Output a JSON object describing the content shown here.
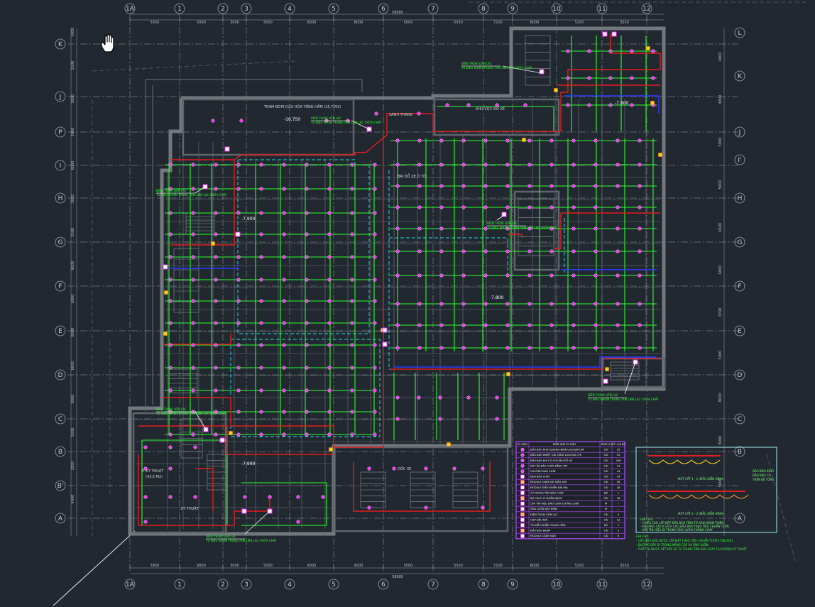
{
  "grid_cols_top": [
    "1A",
    "1",
    "2",
    "3",
    "4",
    "5",
    "6",
    "7",
    "8",
    "9",
    "10",
    "11",
    "12"
  ],
  "grid_cols_bottom": [
    "1A",
    "1",
    "2",
    "3",
    "4",
    "5",
    "6",
    "7",
    "8",
    "9",
    "10",
    "11",
    "12"
  ],
  "grid_rows_left": [
    "K",
    "J",
    "P",
    "I",
    "H",
    "G",
    "F",
    "E",
    "D",
    "C",
    "B",
    "B'",
    "A"
  ],
  "grid_rows_right": [
    "L",
    "K",
    "J",
    "I'",
    "H",
    "G",
    "F",
    "E",
    "D",
    "C",
    "B",
    "A"
  ],
  "dims_top": [
    "5950",
    "5000",
    "3000",
    "5000",
    "8000",
    "8000",
    "5000",
    "5550",
    "7100",
    "8000",
    "5200",
    "3550"
  ],
  "dims_top_total": "58880",
  "dims_bottom": [
    "5950",
    "9000",
    "3000",
    "5000",
    "8000",
    "9000",
    "5000",
    "5550",
    "7100",
    "8000",
    "5200",
    "3550"
  ],
  "dims_bottom_total": "58880",
  "dims_left": [
    "4650",
    "5500",
    "5000",
    "5000",
    "6000",
    "5000",
    "5500",
    "6000",
    "6000",
    "8000",
    "6000",
    "8000",
    "5000",
    "2950",
    "4000"
  ],
  "dims_right": [
    "4000",
    "4800",
    "5000",
    "5000",
    "6500",
    "6000",
    "3700",
    "5000",
    "8000",
    "8000",
    "5000"
  ],
  "rooms": {
    "tank": "TRẠM BƠM CỨU HỎA TẦNG HẦM (25.7 M2)",
    "elev_tank": "-10.750",
    "lobby": "SẢNH THANG",
    "parking_left": "BÃI ĐỖ XE",
    "parking_mid": "KHU VỰC ĐỖ XE",
    "parking_center": "BÃI ĐỖ XE Ô TÔ",
    "ramp": "DỐC XE",
    "tech": "P. KỸ THUẬT",
    "tech_area": "(43.5 M2)",
    "kt_room": "KỸ THUẬT",
    "elev_main": "-7.800",
    "elev_left": "-7.900",
    "elev_right": "-7.800",
    "elev_bottom": "-7.900"
  },
  "callouts": [
    "ĐIỆN THOẠI LIÊN LẠC",
    "TỦ ĐIỀU KHIỂN TRUNG TÂM LIÊN LẠC CHỮA CHÁY"
  ],
  "legend": {
    "headers": [
      "KÝ HIỆU",
      "DIỄN GIẢI KÝ HIỆU",
      "ĐƠN VỊ",
      "SỐ LƯỢNG"
    ],
    "rows": [
      [
        "ĐẦU BÁO KHÓI QUANG ĐIỆN LOẠI ĐỊA CHỈ",
        "CÁI",
        "35"
      ],
      [
        "ĐẦU BÁO NHIỆT GIA TĂNG LOẠI ĐỊA CHỈ",
        "CÁI",
        "12"
      ],
      [
        "ĐẦU BÁO KHÍ CO CHO BÃI ĐỖ XE",
        "CÁI",
        "248"
      ],
      [
        "NÚT ẤN BÁO CHÁY BẰNG TAY",
        "CÁI",
        "14"
      ],
      [
        "CHUÔNG BÁO CHÁY",
        "CÁI",
        "14"
      ],
      [
        "ĐÈN BÁO CHÁY",
        "CÁI",
        "14"
      ],
      [
        "MODULE GIÁM SÁT ĐẦU VÀO",
        "CÁI",
        "26"
      ],
      [
        "MODULE ĐIỀU KHIỂN ĐẦU RA",
        "CÁI",
        "18"
      ],
      [
        "TỦ TRUNG TÂM BÁO CHÁY",
        "BỘ",
        "1"
      ],
      [
        "BỘ CÁCH LY NGẮN MẠCH",
        "CÁI",
        "16"
      ],
      [
        "CÁP TÍN HIỆU BÁO CHÁY CHỐNG CHÁY",
        "M",
        "--"
      ],
      [
        "ỐNG LUỒN DÂY ĐIỆN",
        "M",
        "--"
      ],
      [
        "ĐIỆN THOẠI LIÊN LẠC",
        "CÁI",
        "4"
      ],
      [
        "HỘP ĐẤU NỐI",
        "CÁI",
        "12"
      ],
      [
        "TỦ ĐIỀU KHIỂN TRUNG TÂM",
        "BỘ",
        "1"
      ],
      [
        "ĐẦU BÁO BEAM",
        "CÁI",
        "2"
      ],
      [
        "MODULE CẢNH BÁO",
        "CÁI",
        "6"
      ]
    ]
  },
  "detail": {
    "title_a": "MẶT CẮT 1 - 1 (MẪU ĐIỂN HÌNH)",
    "title_b": "MẶT CẮT 2 - 2 (MẪU ĐIỂN HÌNH)",
    "legend_items": [
      "ĐẦU BÁO KHÓI",
      "ĐẦU BÁO CO",
      "TRẦN BÊ TÔNG"
    ],
    "note_title": "GHI CHÚ:",
    "notes": [
      "- CHIỀU CAO LẮP ĐẶT ĐẦU BÁO TÍNH TỪ SÀN HOÀN THIỆN",
      "- KHOẢNG CÁCH GIỮA CÁC ĐẦU BÁO THEO TIÊU CHUẨN TCVN",
      "- DÂY TÍN HIỆU ĐI TRONG ỐNG LUỒN CHỐNG CHÁY"
    ],
    "footer_notes": [
      "GHI CHÚ:",
      "- CÁC ĐẦU BÁO ĐƯỢC LẮP ĐẶT THEO TIÊU CHUẨN TCVN 5738:2021",
      "- ĐƯỜNG DÂY ĐI TRONG MÁNG CÁP VÀ ỐNG LUỒN",
      "- THIẾT BỊ ĐƯỢC KẾT NỐI VỀ TỦ TRUNG TÂM BÁO CHÁY TẠI PHÒNG KỸ THUẬT"
    ]
  },
  "colors": {
    "background": "#212830",
    "wall": "#6b7075",
    "grid": "#8a8f94",
    "fire_loop_green": "#2cff2c",
    "main_cable_red": "#e01e1e",
    "cable_blue": "#2a3cff",
    "detector_magenta": "#ff2cff",
    "cyan_dashed": "#22d8e0",
    "device_yellow": "#ffd21e"
  },
  "cursor_icon": "hand-pan-icon"
}
